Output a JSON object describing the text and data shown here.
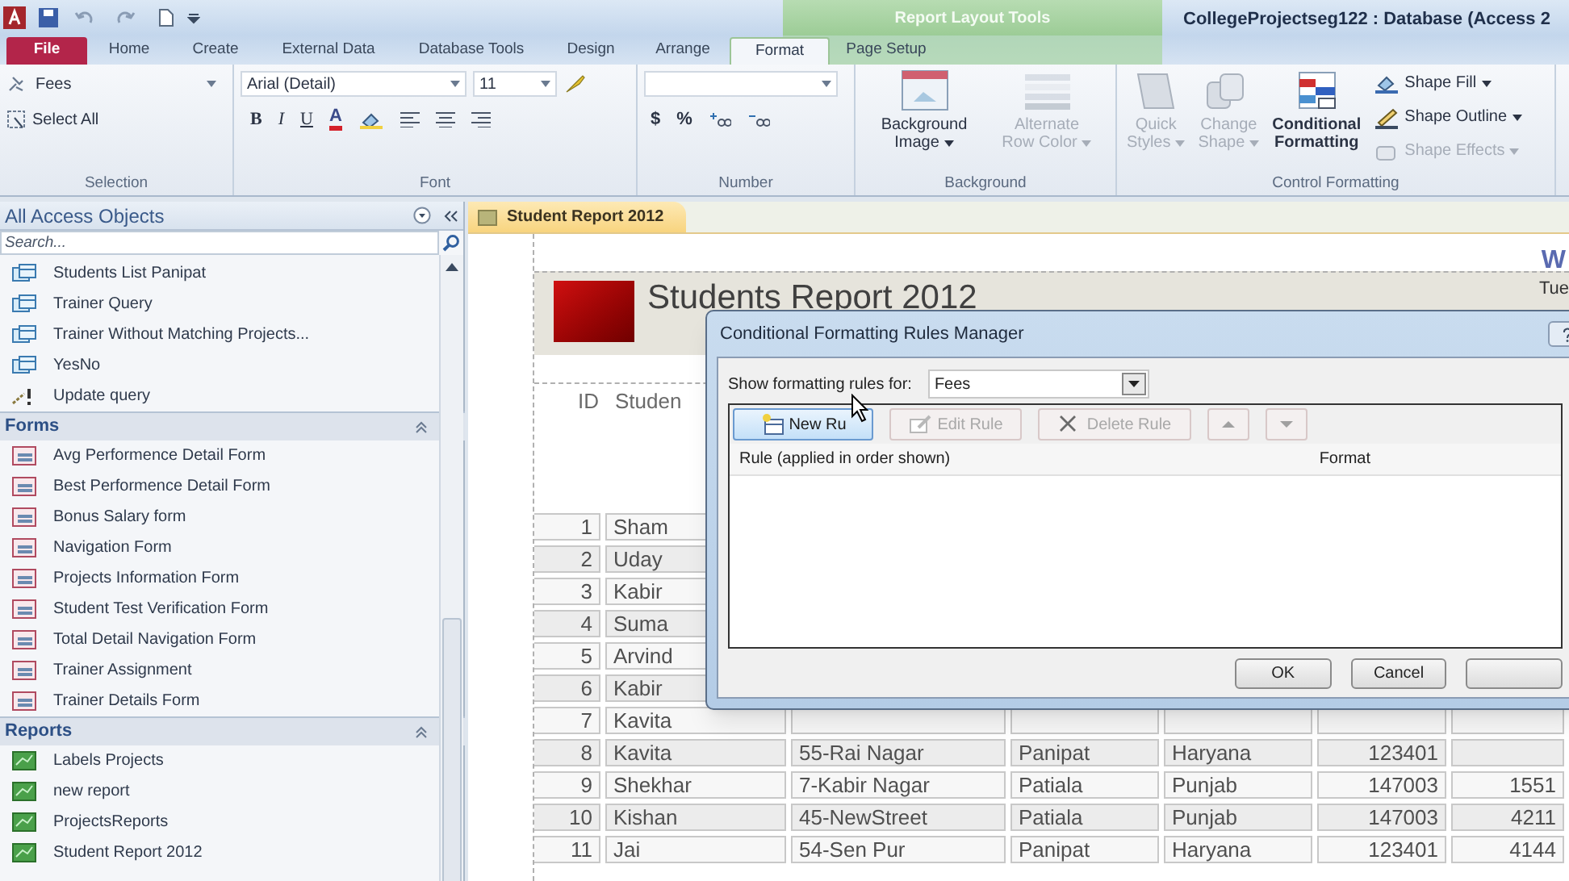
{
  "title_bar": {
    "title": "CollegeProjectseg122 : Database (Access 2",
    "context_label": "Report Layout Tools"
  },
  "ribbon_tabs": [
    {
      "label": "File",
      "kind": "file",
      "selected": false
    },
    {
      "label": "Home",
      "kind": "plain",
      "selected": false
    },
    {
      "label": "Create",
      "kind": "plain",
      "selected": false
    },
    {
      "label": "External Data",
      "kind": "plain",
      "selected": false
    },
    {
      "label": "Database Tools",
      "kind": "plain",
      "selected": false
    },
    {
      "label": "Design",
      "kind": "context",
      "selected": false
    },
    {
      "label": "Arrange",
      "kind": "context",
      "selected": false
    },
    {
      "label": "Format",
      "kind": "context",
      "selected": true
    },
    {
      "label": "Page Setup",
      "kind": "context",
      "selected": false
    }
  ],
  "selection_group": {
    "label": "Selection",
    "object_box": "Fees",
    "select_all": "Select All"
  },
  "font_group": {
    "label": "Font",
    "font_name": "Arial (Detail)",
    "font_size": "11",
    "bold": "B",
    "italic": "I",
    "underline": "U",
    "font_color": "A"
  },
  "number_group": {
    "label": "Number",
    "buttons": [
      "$",
      "%"
    ]
  },
  "background_group": {
    "label": "Background",
    "buttons": [
      {
        "kind": "background-image",
        "lines": [
          "Background",
          "Image"
        ],
        "disabled": false
      },
      {
        "kind": "alternate-row",
        "lines": [
          "Alternate",
          "Row Color"
        ],
        "disabled": true
      }
    ]
  },
  "control_formatting_group": {
    "label": "Control Formatting",
    "large_buttons": [
      {
        "kind": "quick-styles",
        "lines": [
          "Quick",
          "Styles"
        ],
        "disabled": true,
        "dropdown": true
      },
      {
        "kind": "change-shape",
        "lines": [
          "Change",
          "Shape"
        ],
        "disabled": true,
        "dropdown": true
      },
      {
        "kind": "conditional",
        "lines": [
          "Conditional",
          "Formatting"
        ],
        "disabled": false,
        "dropdown": false
      }
    ],
    "small_buttons": [
      {
        "kind": "fill",
        "label": "Shape Fill",
        "disabled": false
      },
      {
        "kind": "outline",
        "label": "Shape Outline",
        "disabled": false
      },
      {
        "kind": "effects",
        "label": "Shape Effects",
        "disabled": true
      }
    ]
  },
  "nav_pane": {
    "title": "All Access Objects",
    "search_placeholder": "Search...",
    "groups": [
      {
        "items": [
          {
            "label": "Students List Panipat",
            "kind": "query"
          },
          {
            "label": "Trainer Query",
            "kind": "query"
          },
          {
            "label": "Trainer Without Matching Projects...",
            "kind": "query"
          },
          {
            "label": "YesNo",
            "kind": "query"
          },
          {
            "label": "Update query",
            "kind": "action-query"
          }
        ]
      },
      {
        "title": "Forms",
        "expanded": true,
        "items": [
          {
            "label": "Avg Performence Detail Form",
            "kind": "form"
          },
          {
            "label": "Best Performence Detail Form",
            "kind": "form"
          },
          {
            "label": "Bonus Salary form",
            "kind": "form"
          },
          {
            "label": "Navigation Form",
            "kind": "form"
          },
          {
            "label": "Projects Information Form",
            "kind": "form"
          },
          {
            "label": "Student Test Verification Form",
            "kind": "form"
          },
          {
            "label": "Total Detail Navigation Form",
            "kind": "form"
          },
          {
            "label": "Trainer Assignment",
            "kind": "form"
          },
          {
            "label": "Trainer Details Form",
            "kind": "form"
          }
        ]
      },
      {
        "title": "Reports",
        "expanded": true,
        "items": [
          {
            "label": "Labels Projects",
            "kind": "report"
          },
          {
            "label": "new report",
            "kind": "report"
          },
          {
            "label": "ProjectsReports",
            "kind": "report"
          },
          {
            "label": "Student Report 2012",
            "kind": "report"
          }
        ]
      }
    ]
  },
  "report": {
    "tab": "Student Report 2012",
    "title": "Students  Report 2012",
    "corner_text": "W",
    "date_text": "Tue",
    "columns": [
      "ID",
      "Studen"
    ],
    "rows": [
      {
        "cells": [
          "1",
          "Sham"
        ]
      },
      {
        "cells": [
          "2",
          "Uday"
        ]
      },
      {
        "cells": [
          "3",
          "Kabir"
        ]
      },
      {
        "cells": [
          "4",
          "Suma"
        ]
      },
      {
        "cells": [
          "5",
          "Arvind"
        ]
      },
      {
        "cells": [
          "6",
          "Kabir"
        ]
      },
      {
        "cells": [
          "7",
          "Kavita"
        ]
      },
      {
        "cells": [
          "8",
          "Kavita",
          "55-Rai Nagar",
          "Panipat",
          "Haryana",
          "123401"
        ]
      },
      {
        "cells": [
          "9",
          "Shekhar",
          "7-Kabir Nagar",
          "Patiala",
          "Punjab",
          "147003",
          "1551"
        ]
      },
      {
        "cells": [
          "10",
          "Kishan",
          "45-NewStreet",
          "Patiala",
          "Punjab",
          "147003",
          "4211"
        ]
      },
      {
        "cells": [
          "11",
          "Jai",
          "54-Sen Pur",
          "Panipat",
          "Haryana",
          "123401",
          "4144"
        ]
      }
    ]
  },
  "dialog": {
    "title": "Conditional Formatting Rules Manager",
    "show_label": "Show formatting rules for:",
    "field": "Fees",
    "toolbar": [
      {
        "kind": "new",
        "label": "New Ru",
        "disabled": false
      },
      {
        "kind": "edit",
        "label": "Edit Rule",
        "disabled": true
      },
      {
        "kind": "delete",
        "label": "Delete Rule",
        "disabled": true
      },
      {
        "kind": "up",
        "disabled": true
      },
      {
        "kind": "down",
        "disabled": true
      }
    ],
    "list_columns": [
      "Rule (applied in order shown)",
      "Format"
    ],
    "buttons": [
      "OK",
      "Cancel"
    ]
  }
}
